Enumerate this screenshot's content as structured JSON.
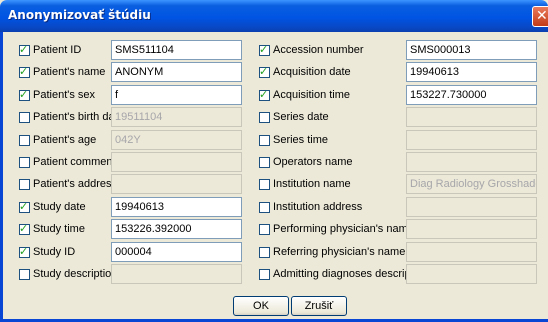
{
  "window": {
    "title": "Anonymizovať štúdiu",
    "close_glyph": "✕"
  },
  "left_rows": [
    {
      "label": "Patient ID",
      "checked": true,
      "value": "SMS511104",
      "enabled": true
    },
    {
      "label": "Patient's name",
      "checked": true,
      "value": "ANONYM",
      "enabled": true
    },
    {
      "label": "Patient's sex",
      "checked": true,
      "value": "f",
      "enabled": true
    },
    {
      "label": "Patient's birth date",
      "checked": false,
      "value": "19511104",
      "enabled": false
    },
    {
      "label": "Patient's age",
      "checked": false,
      "value": "042Y",
      "enabled": false
    },
    {
      "label": "Patient comments",
      "checked": false,
      "value": "",
      "enabled": false
    },
    {
      "label": "Patient's address",
      "checked": false,
      "value": "",
      "enabled": false
    },
    {
      "label": "Study date",
      "checked": true,
      "value": "19940613",
      "enabled": true
    },
    {
      "label": "Study time",
      "checked": true,
      "value": "153226.392000",
      "enabled": true
    },
    {
      "label": "Study ID",
      "checked": true,
      "value": "000004",
      "enabled": true
    },
    {
      "label": "Study description",
      "checked": false,
      "value": "",
      "enabled": false
    }
  ],
  "right_rows": [
    {
      "label": "Accession number",
      "checked": true,
      "value": "SMS000013",
      "enabled": true
    },
    {
      "label": "Acquisition date",
      "checked": true,
      "value": "19940613",
      "enabled": true
    },
    {
      "label": "Acquisition time",
      "checked": true,
      "value": "153227.730000",
      "enabled": true
    },
    {
      "label": "Series date",
      "checked": false,
      "value": "",
      "enabled": false
    },
    {
      "label": "Series time",
      "checked": false,
      "value": "",
      "enabled": false
    },
    {
      "label": "Operators name",
      "checked": false,
      "value": "",
      "enabled": false
    },
    {
      "label": "Institution name",
      "checked": false,
      "value": "Diag Radiology Grosshadern",
      "enabled": false
    },
    {
      "label": "Institution address",
      "checked": false,
      "value": "",
      "enabled": false
    },
    {
      "label": "Performing physician's name",
      "checked": false,
      "value": "",
      "enabled": false
    },
    {
      "label": "Referring physician's name",
      "checked": false,
      "value": "",
      "enabled": false
    },
    {
      "label": "Admitting diagnoses description",
      "checked": false,
      "value": "",
      "enabled": false
    }
  ],
  "buttons": {
    "ok": "OK",
    "cancel": "Zrušiť"
  },
  "colors": {
    "titlebar": "#0054e3",
    "dialog_bg": "#ece9d8",
    "check": "#21a121",
    "field_border": "#7f9db9"
  }
}
